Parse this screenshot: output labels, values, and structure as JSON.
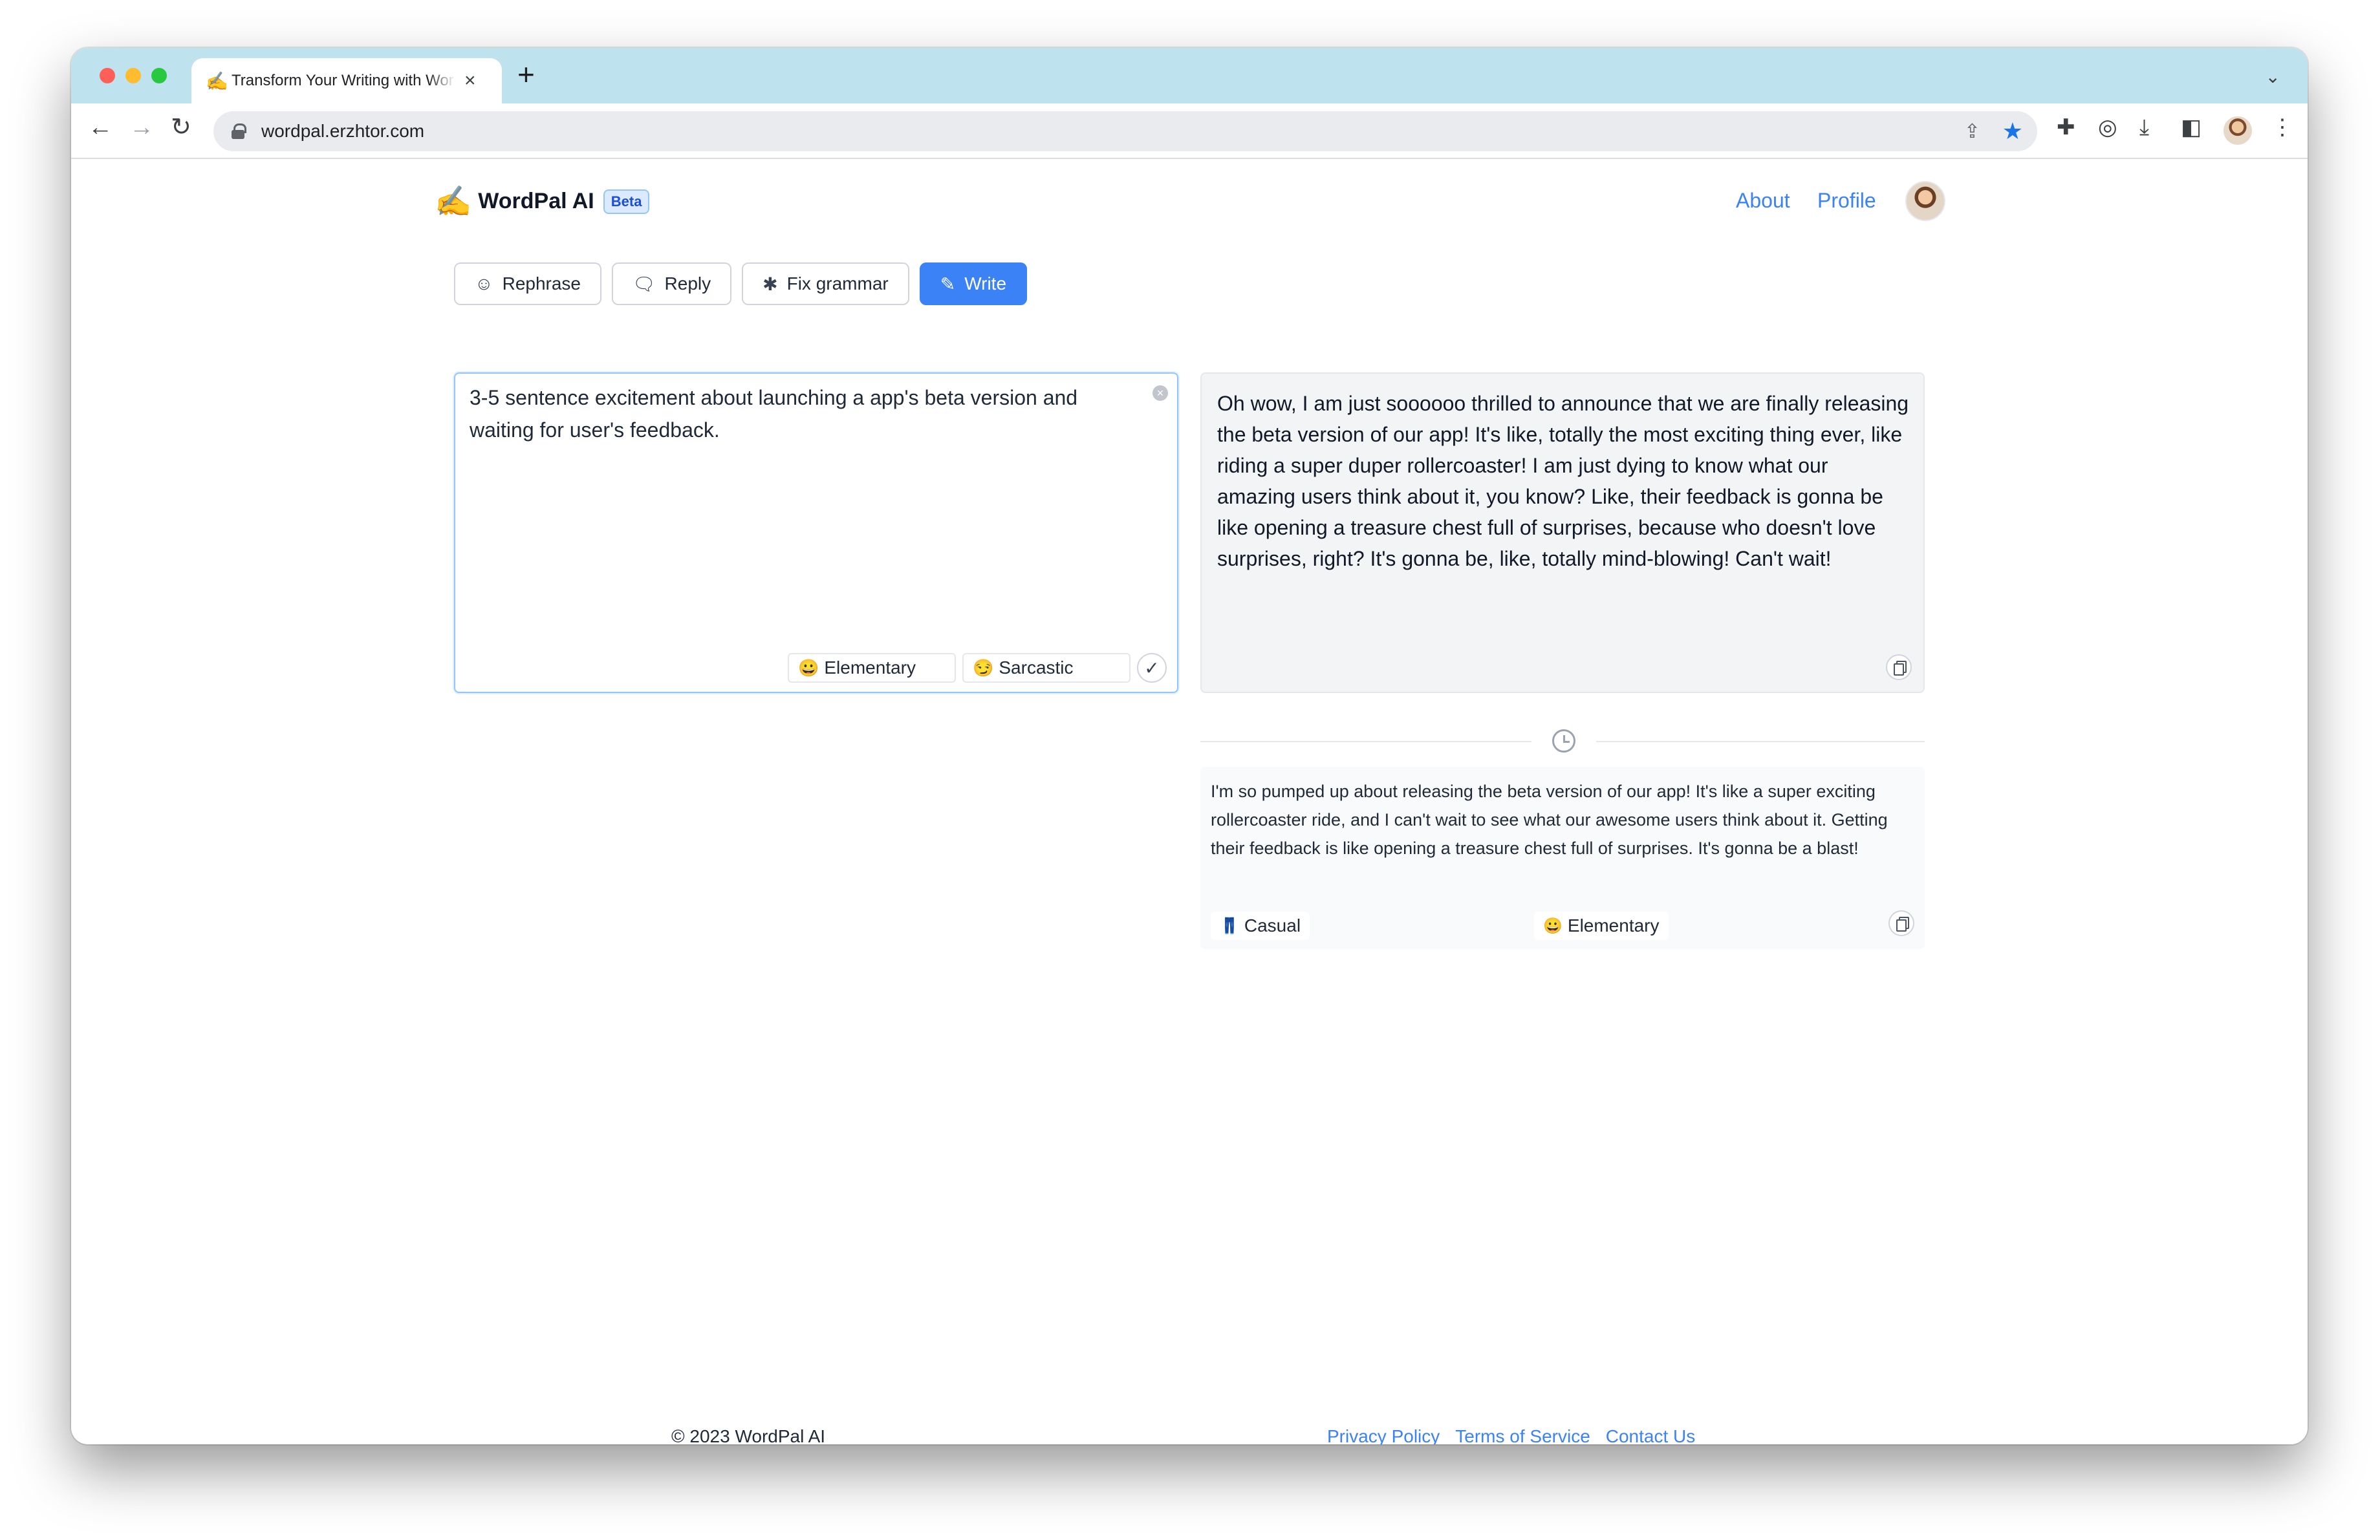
{
  "browser": {
    "tab": {
      "favicon": "✍️",
      "title": "Transform Your Writing with WordPal AI"
    },
    "new_tab_icon": "+",
    "url": "wordpal.erzhtor.com"
  },
  "app": {
    "brand_emoji": "✍️",
    "name": "WordPal AI",
    "badge": "Beta",
    "nav": {
      "about": "About",
      "profile": "Profile"
    }
  },
  "modes": [
    {
      "label": "Rephrase",
      "icon": "chat-icon",
      "glyph": "☺",
      "active": false
    },
    {
      "label": "Reply",
      "icon": "reply-icon",
      "glyph": "🗨",
      "active": false
    },
    {
      "label": "Fix grammar",
      "icon": "bug-icon",
      "glyph": "✱",
      "active": false
    },
    {
      "label": "Write",
      "icon": "pencil-icon",
      "glyph": "✎",
      "active": true
    }
  ],
  "input": {
    "text": "3-5 sentence excitement about launching a app's beta version and waiting for user's feedback.",
    "chips": [
      {
        "emoji": "😀",
        "label": "Elementary"
      },
      {
        "emoji": "😏",
        "label": "Sarcastic"
      }
    ]
  },
  "output": {
    "text": "Oh wow, I am just soooooo thrilled to announce that we are finally releasing the beta version of our app! It's like, totally the most exciting thing ever, like riding a super duper rollercoaster! I am just dying to know what our amazing users think about it, you know? Like, their feedback is gonna be like opening a treasure chest full of surprises, because who doesn't love surprises, right? It's gonna be, like, totally mind-blowing! Can't wait!"
  },
  "history": [
    {
      "text": "I'm so pumped up about releasing the beta version of our app! It's like a super exciting rollercoaster ride, and I can't wait to see what our awesome users think about it. Getting their feedback is like opening a treasure chest full of surprises. It's gonna be a blast!",
      "tags": [
        {
          "emoji": "👖",
          "label": "Casual"
        },
        {
          "emoji": "😀",
          "label": "Elementary"
        }
      ]
    }
  ],
  "footer": {
    "copyright": "© 2023 WordPal AI",
    "links": [
      "Privacy Policy",
      "Terms of Service",
      "Contact Us"
    ]
  },
  "colors": {
    "accent": "#3b82f6",
    "tabstrip": "#bfe3ee"
  }
}
